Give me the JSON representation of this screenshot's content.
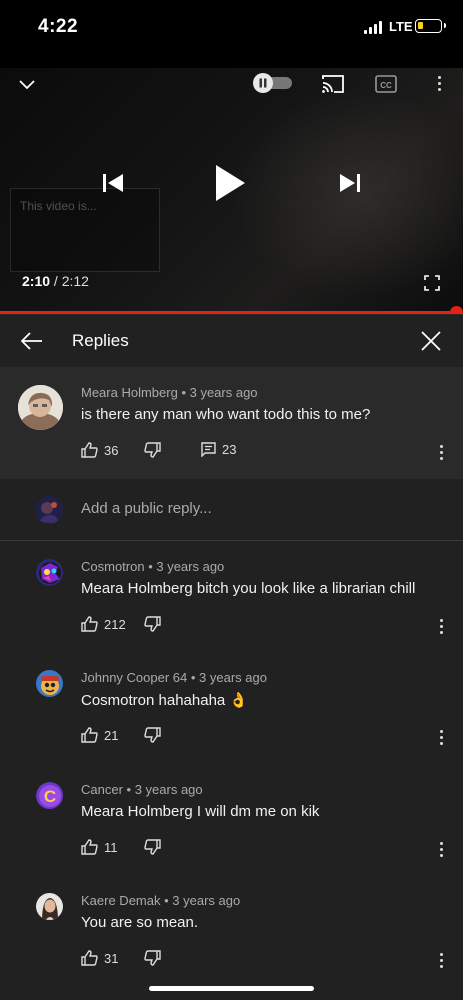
{
  "status_bar": {
    "time": "4:22",
    "network": "LTE",
    "battery_color": "#f5d31b"
  },
  "player": {
    "overlay_text": "This video is...",
    "current_time": "2:10",
    "separator": " / ",
    "duration": "2:12",
    "progress_fraction": 0.984,
    "accent_color": "#e62117",
    "icons": [
      "chevron-down-icon",
      "autoplay-toggle",
      "cast-icon",
      "captions-icon",
      "more-vert-icon",
      "skip-previous-icon",
      "play-icon",
      "skip-next-icon",
      "fullscreen-icon"
    ]
  },
  "replies_header": {
    "title": "Replies",
    "icons": [
      "back-arrow-icon",
      "close-icon"
    ]
  },
  "parent_comment": {
    "author": "Meara Holmberg",
    "age": "3 years ago",
    "text": "is there any man who want todo this to me?",
    "likes": "36",
    "replies": "23"
  },
  "reply_input": {
    "placeholder": "Add a public reply..."
  },
  "replies": [
    {
      "author": "Cosmotron",
      "age": "3 years ago",
      "text": "Meara Holmberg bitch you look like a librarian chill",
      "likes": "212"
    },
    {
      "author": "Johnny Cooper 64",
      "age": "3 years ago",
      "text": "Cosmotron hahahaha 👌",
      "likes": "21"
    },
    {
      "author": "Cancer",
      "age": "3 years ago",
      "text": "Meara Holmberg I will dm me on kik",
      "likes": "11"
    },
    {
      "author": "Kaere Demak",
      "age": "3 years ago",
      "text": "You are so mean.",
      "likes": "31"
    }
  ]
}
